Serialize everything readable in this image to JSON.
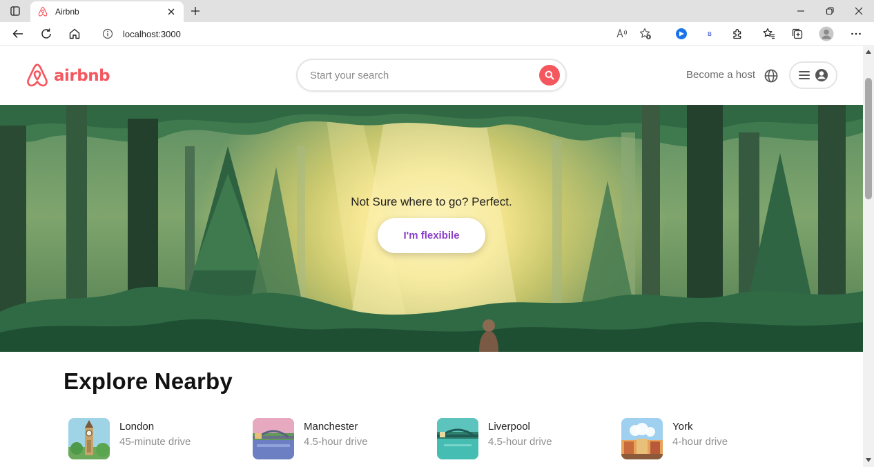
{
  "browser": {
    "tab_title": "Airbnb",
    "url": "localhost:3000",
    "profile_badge": "B"
  },
  "header": {
    "logo_text": "airbnb",
    "search_placeholder": "Start your search",
    "become_host": "Become a host"
  },
  "hero": {
    "tagline": "Not Sure where to go? Perfect.",
    "button_label": "I'm flexibile"
  },
  "explore": {
    "heading": "Explore Nearby",
    "items": [
      {
        "city": "London",
        "distance": "45-minute drive"
      },
      {
        "city": "Manchester",
        "distance": "4.5-hour drive"
      },
      {
        "city": "Liverpool",
        "distance": "4.5-hour drive"
      },
      {
        "city": "York",
        "distance": "4-hour drive"
      }
    ]
  },
  "colors": {
    "brand": "#f5575f",
    "flexible_text": "#8b3fc9"
  },
  "icons": [
    "tab-actions-icon",
    "airbnb-favicon",
    "close-icon",
    "plus-icon",
    "minimize-icon",
    "restore-icon",
    "back-icon",
    "refresh-icon",
    "home-icon",
    "info-icon",
    "read-aloud-icon",
    "add-favorite-icon",
    "extension-icon",
    "puzzle-icon",
    "favorites-icon",
    "collections-icon",
    "profile-avatar",
    "more-icon",
    "search-icon",
    "globe-icon",
    "menu-icon",
    "user-icon"
  ]
}
